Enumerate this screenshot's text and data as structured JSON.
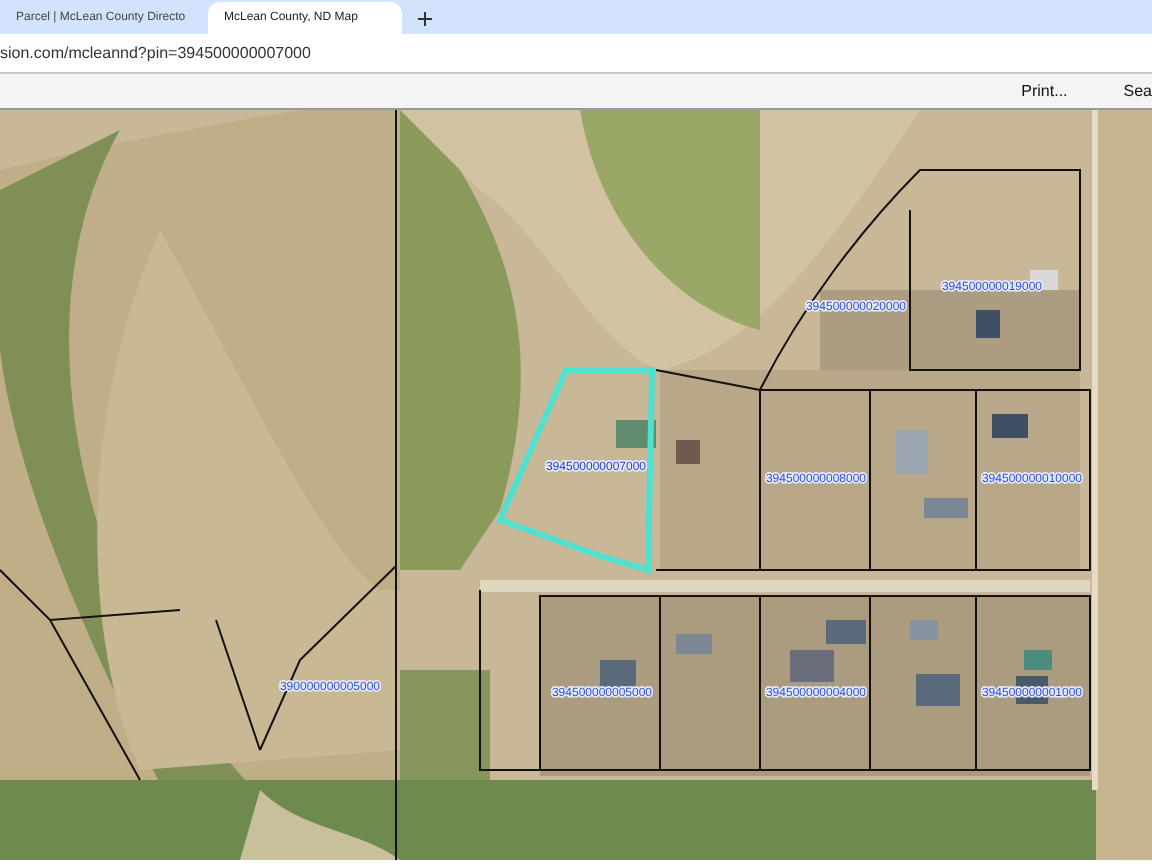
{
  "browser_tabs": [
    {
      "title": "Parcel | McLean County Directo",
      "selected": false
    },
    {
      "title": "McLean County, ND Map",
      "selected": true
    }
  ],
  "address": "sion.com/mcleannd?pin=394500000007000",
  "toolbar": [
    "Print...",
    "Sea"
  ],
  "parcels": [
    {
      "label": "394500000020000",
      "selected": false
    },
    {
      "label": "394500000019000",
      "selected": false
    },
    {
      "label": "394500000007000",
      "selected": true
    },
    {
      "label": "394500000008000",
      "selected": false
    },
    {
      "label": "394500000010000",
      "selected": false
    },
    {
      "label": "390000000005000",
      "selected": false
    },
    {
      "label": "394500000005000",
      "selected": false
    },
    {
      "label": "394500000004000",
      "selected": false
    },
    {
      "label": "394500000001000",
      "selected": false
    }
  ]
}
